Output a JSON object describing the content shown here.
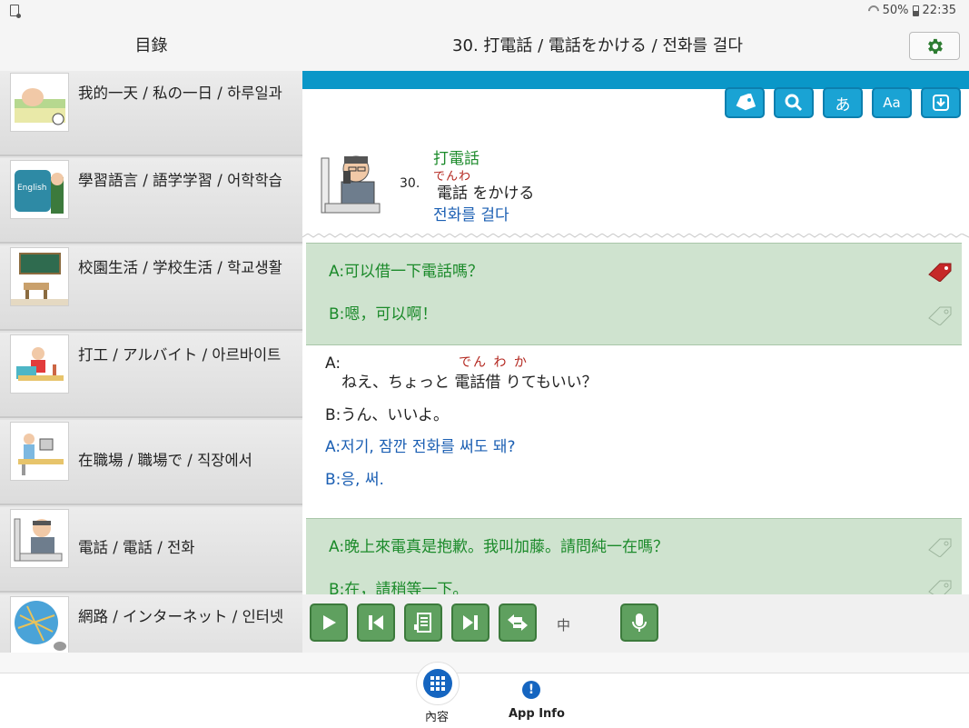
{
  "status_bar": {
    "battery": "50%",
    "time": "22:35"
  },
  "header": {
    "toc_title": "目錄",
    "lesson_title": "30. 打電話 / 電話をかける / 전화를 걸다"
  },
  "sidebar": {
    "items": [
      {
        "label": "我的一天 / 私の一日 / 하루일과",
        "thumb": "sleeping-person"
      },
      {
        "label": "學習語言 / 語学学習 / 어학학습",
        "thumb": "english-book"
      },
      {
        "label": "校園生活 / 学校生活 / 학교생활",
        "thumb": "classroom"
      },
      {
        "label": "打工 / アルバイト / 아르바이트",
        "thumb": "cashier"
      },
      {
        "label": "在職場 / 職場で / 직장에서",
        "thumb": "office-worker"
      },
      {
        "label": "電話 / 電話 / 전화",
        "thumb": "phone-caller"
      },
      {
        "label": "網路 / インターネット / 인터넷",
        "thumb": "globe-mouse"
      }
    ]
  },
  "toolbar": {
    "icons": [
      "tag-icon",
      "search-icon",
      "hiragana-icon",
      "font-size-icon",
      "download-icon"
    ],
    "hiragana_label": "あ",
    "font_label": "Aa"
  },
  "lesson": {
    "number": "30.",
    "zh": "打電話",
    "ja_furigana": "でんわ",
    "ja": "電話 をかける",
    "ko": "전화를 걸다"
  },
  "dialogues": [
    {
      "zh": {
        "a": "A:可以借一下電話嗎？",
        "b": "B:嗯，可以啊！"
      },
      "ja_a_prefix": "A:",
      "ja_a_furigana": "でん わ か",
      "ja_a": "ねえ、ちょっと 電話借 りてもいい？",
      "ja_b": "B:うん、いいよ。",
      "ko_a": "A:저기, 잠깐 전화를 써도 돼?",
      "ko_b": "B:응, 써."
    },
    {
      "zh": {
        "a": "A:晚上來電真是抱歉。我叫加藤。請問純一在嗎？",
        "b": "B:在，請稍等一下。"
      }
    }
  ],
  "player": {
    "speed_label": "中",
    "buttons": [
      "play-icon",
      "previous-icon",
      "text-icon",
      "next-icon",
      "repeat-icon",
      "microphone-icon"
    ]
  },
  "bottom_nav": {
    "contents_label": "內容",
    "info_label": "App Info",
    "info_symbol": "!"
  },
  "colors": {
    "accent_blue": "#0a97c8",
    "toolbar_button": "#1aa3d4",
    "player_green": "#5fa05f",
    "zh_green": "#1b8a2a",
    "ko_blue": "#1b5fb3",
    "furigana_red": "#b3261e",
    "dialog_bg": "#cfe3cf"
  }
}
